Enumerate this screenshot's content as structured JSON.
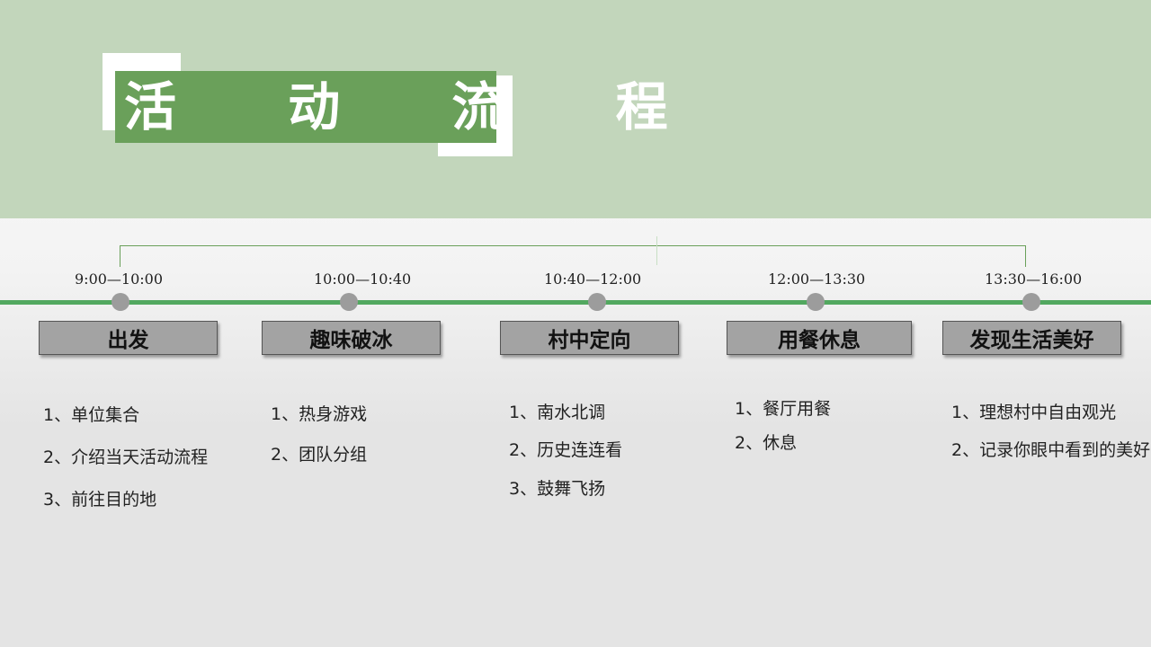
{
  "title": "活 动 流 程",
  "stages": [
    {
      "time": "9:00—10:00",
      "label": "出发",
      "items": [
        "1、单位集合",
        "2、介绍当天活动流程",
        "3、前往目的地"
      ]
    },
    {
      "time": "10:00—10:40",
      "label": "趣味破冰",
      "items": [
        "1、热身游戏",
        "2、团队分组"
      ]
    },
    {
      "time": "10:40—12:00",
      "label": "村中定向",
      "items": [
        "1、南水北调",
        "2、历史连连看",
        "3、鼓舞飞扬"
      ]
    },
    {
      "time": "12:00—13:30",
      "label": "用餐休息",
      "items": [
        "1、餐厅用餐",
        "2、休息"
      ]
    },
    {
      "time": "13:30—16:00",
      "label": "发现生活美好",
      "items": [
        "1、理想村中自由观光",
        "2、记录你眼中看到的美好"
      ]
    }
  ]
}
